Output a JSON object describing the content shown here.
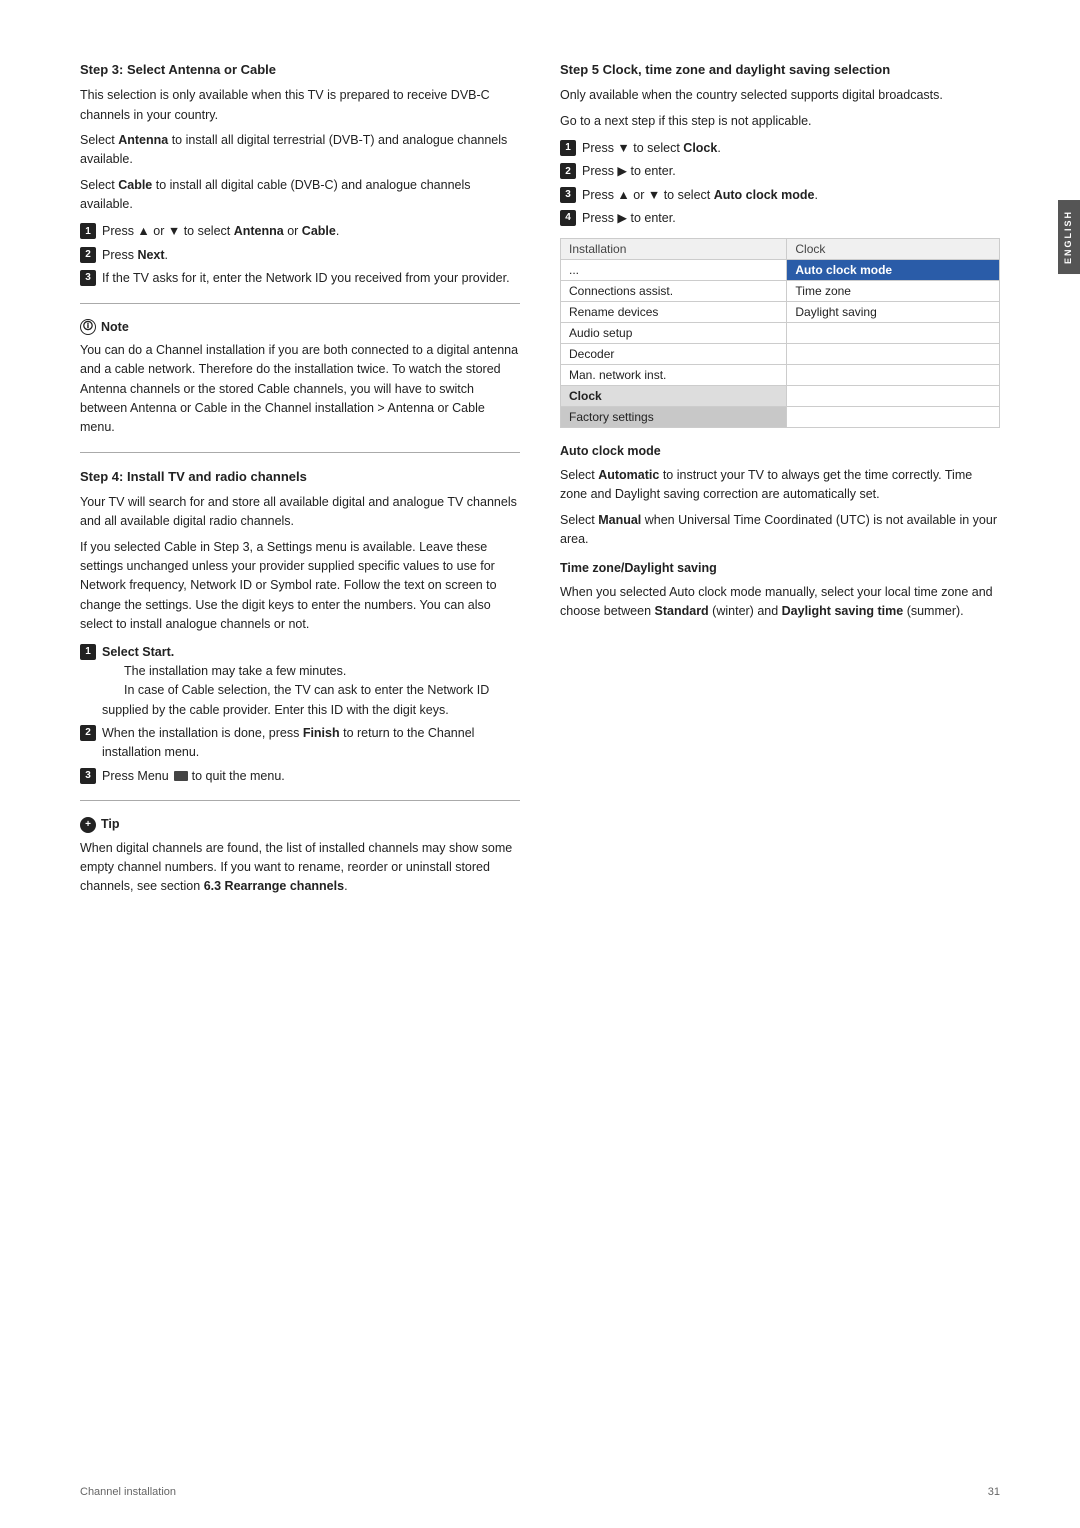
{
  "page": {
    "footer_left": "Channel installation",
    "footer_right": "31",
    "english_label": "ENGLISH"
  },
  "left_col": {
    "step3": {
      "title": "Step 3:  Select Antenna or Cable",
      "para1": "This selection is only available when this TV is prepared to receive DVB-C channels in your country.",
      "para2_prefix": "Select ",
      "para2_bold": "Antenna",
      "para2_mid": " to install all digital terrestrial (DVB-T) and analogue channels available.",
      "para3_prefix": "Select ",
      "para3_bold": "Cable",
      "para3_mid": " to install all digital cable (DVB-C) and analogue channels available.",
      "steps": [
        {
          "num": "1",
          "text_prefix": "Press ▲ or ▼ to select ",
          "text_bold1": "Antenna",
          "text_mid": " or ",
          "text_bold2": "Cable",
          "text_suffix": "."
        },
        {
          "num": "2",
          "text_prefix": "Press ",
          "text_bold": "Next",
          "text_suffix": "."
        },
        {
          "num": "3",
          "text": "If the TV asks for it, enter the Network ID you received from your provider."
        }
      ]
    },
    "note": {
      "title": "Note",
      "text": "You can do a Channel installation if you are both connected to a digital antenna and a cable network. Therefore do the installation twice. To watch the stored Antenna channels or the stored Cable channels, you will have to switch between Antenna or Cable in the Channel installation > Antenna or Cable menu."
    },
    "step4": {
      "title": "Step 4: Install TV and radio channels",
      "para1": "Your TV will search for and store all available digital and analogue TV channels and all available digital radio channels.",
      "para2": "If you selected Cable in Step 3, a Settings menu is available. Leave these settings unchanged unless your provider supplied specific values to use for Network frequency, Network ID or Symbol rate. Follow the text on screen to change the settings. Use the digit keys to enter the numbers. You can also select to install analogue channels or not.",
      "steps": [
        {
          "num": "1",
          "text_bold": "Select Start.",
          "sub": [
            "The installation may take a few minutes.",
            "In case of Cable selection, the TV can ask to enter the Network ID supplied by the cable provider. Enter this ID with the digit keys."
          ]
        },
        {
          "num": "2",
          "text_prefix": "When the installation is done, press ",
          "text_bold": "Finish",
          "text_suffix": " to return to the Channel installation menu."
        },
        {
          "num": "3",
          "text_prefix": "Press Menu ",
          "text_icon": true,
          "text_suffix": " to quit the menu."
        }
      ]
    },
    "tip": {
      "title": "Tip",
      "text": "When digital channels are found, the list of installed channels may show some empty channel numbers. If you want to rename, reorder or uninstall stored channels, see section ",
      "text_bold": "6.3 Rearrange channels",
      "text_end": "."
    }
  },
  "right_col": {
    "step5": {
      "title": "Step 5  Clock, time zone and daylight saving selection",
      "para1": "Only available when the country selected supports digital broadcasts.",
      "para2": "Go to a next step if this step is not applicable.",
      "steps": [
        {
          "num": "1",
          "text_prefix": "Press ▼ to select ",
          "text_bold": "Clock",
          "text_suffix": "."
        },
        {
          "num": "2",
          "text": "Press ▶ to enter."
        },
        {
          "num": "3",
          "text_prefix": "Press ▲ or ▼ to select ",
          "text_bold": "Auto clock mode",
          "text_suffix": "."
        },
        {
          "num": "4",
          "text": "Press ▶ to enter."
        }
      ]
    },
    "menu": {
      "col1_header": "Installation",
      "col2_header": "Clock",
      "rows": [
        {
          "col1": "...",
          "col2": "Auto clock mode",
          "col2_highlight": true
        },
        {
          "col1": "Connections assist.",
          "col2": "Time zone"
        },
        {
          "col1": "Rename devices",
          "col2": "Daylight saving"
        },
        {
          "col1": "Audio setup",
          "col2": ""
        },
        {
          "col1": "Decoder",
          "col2": ""
        },
        {
          "col1": "Man. network inst.",
          "col2": ""
        },
        {
          "col1": "Clock",
          "col2": "",
          "col1_active": true
        },
        {
          "col1": "Factory settings",
          "col2": "",
          "col1_gray": true
        }
      ]
    },
    "auto_clock": {
      "title": "Auto clock mode",
      "para1_prefix": "Select ",
      "para1_bold": "Automatic",
      "para1_mid": " to instruct your TV to always get the time correctly. Time zone and Daylight saving correction are automatically set.",
      "para2_prefix": "Select ",
      "para2_bold": "Manual",
      "para2_mid": " when Universal Time Coordinated (UTC) is not available in your area."
    },
    "timezone": {
      "title": "Time zone/Daylight saving",
      "para1": "When you selected Auto clock mode manually, select your local time zone and choose between ",
      "para1_bold1": "Standard",
      "para1_mid": " (winter) and ",
      "para1_bold2": "Daylight saving time",
      "para1_end": " (summer)."
    }
  }
}
